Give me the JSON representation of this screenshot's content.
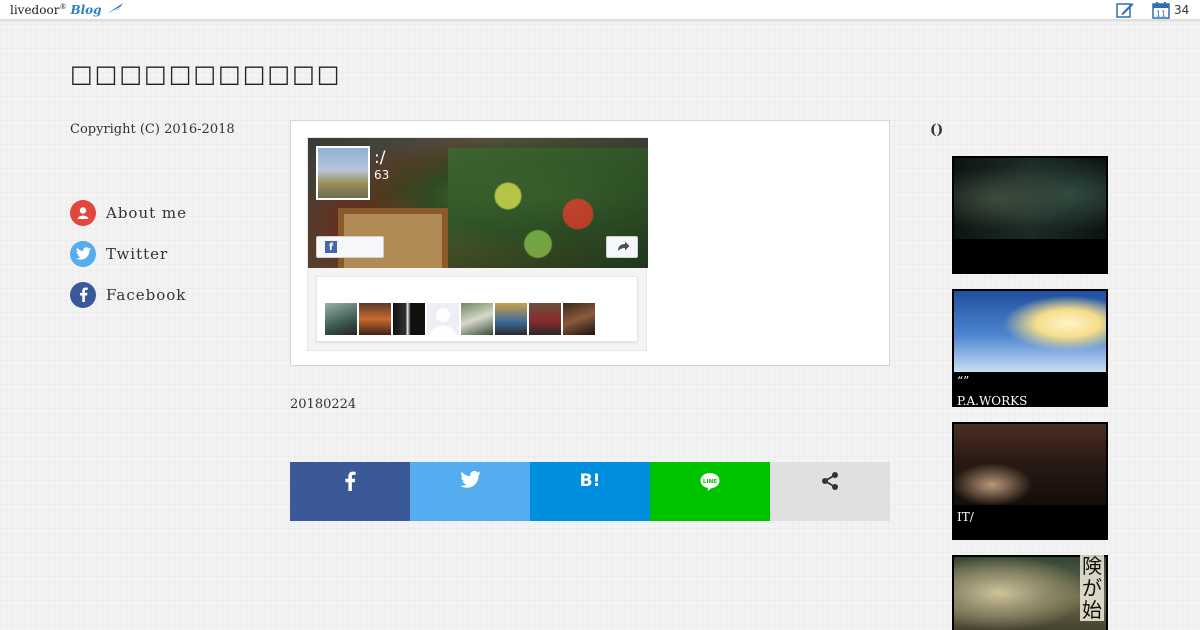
{
  "topbar": {
    "logo_text": "livedoor",
    "logo_suffix": "Blog",
    "calendar_count": "34"
  },
  "blog": {
    "title": "□□□□□□□□□□□",
    "copyright": "Copyright (C) 2016-2018"
  },
  "profile_links": [
    {
      "label": "About me",
      "icon": "person-icon",
      "color": "#e2463d"
    },
    {
      "label": "Twitter",
      "icon": "twitter-icon",
      "color": "#55acee"
    },
    {
      "label": "Facebook",
      "icon": "facebook-icon",
      "color": "#3b5998"
    }
  ],
  "facebook_widget": {
    "page_name": ":/",
    "likes": "63",
    "faces_count": 8
  },
  "post": {
    "date": "20180224"
  },
  "share_buttons": [
    {
      "label": "f",
      "service": "facebook",
      "color": "#3b5998"
    },
    {
      "label": "",
      "service": "twitter",
      "color": "#55acee"
    },
    {
      "label": "B!",
      "service": "hatena",
      "color": "#008fde"
    },
    {
      "label": "LINE",
      "service": "line",
      "color": "#00c300"
    },
    {
      "label": "",
      "service": "share",
      "color": "#e0e0e0"
    }
  ],
  "sidebar": {
    "heading": "()",
    "articles": [
      {
        "caption_line1": "",
        "caption_line2": ""
      },
      {
        "caption_line1": "“”",
        "caption_line2": "P.A.WORKS"
      },
      {
        "caption_line1": "",
        "caption_line2": "IT/"
      },
      {
        "caption_line1": "",
        "caption_line2": "",
        "kanji": "険が始"
      }
    ]
  }
}
